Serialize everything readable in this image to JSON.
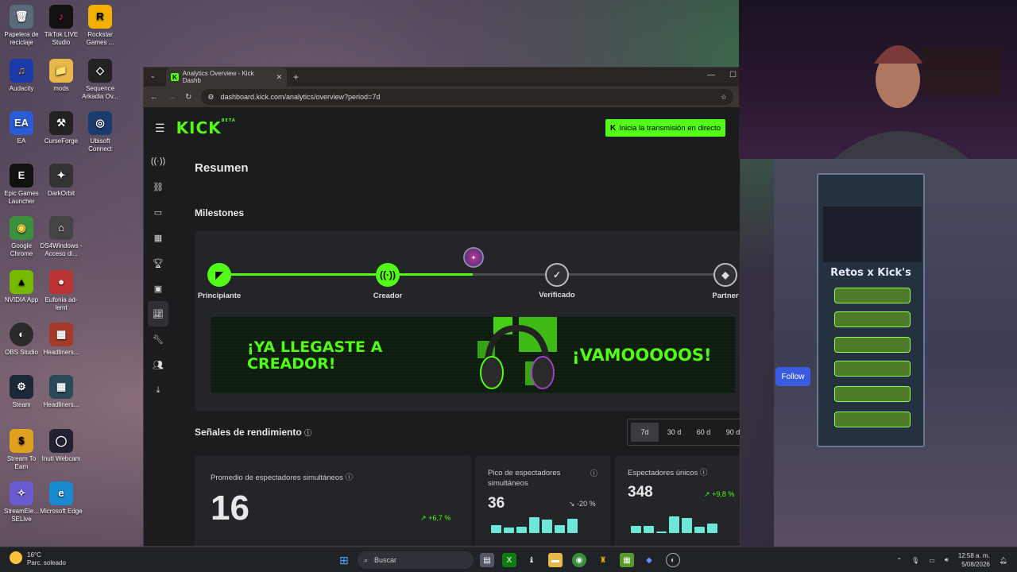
{
  "desktop": {
    "icons": [
      {
        "label": "Papelera de reciclaje",
        "glyph": "🗑"
      },
      {
        "label": "TikTok LIVE Studio",
        "glyph": "♪"
      },
      {
        "label": "Rockstar Games ...",
        "glyph": "R"
      },
      {
        "label": "Audacity",
        "glyph": "♫"
      },
      {
        "label": "mods",
        "glyph": "📁"
      },
      {
        "label": "Sequence Arkadia Ov...",
        "glyph": "◇"
      },
      {
        "label": "EA",
        "glyph": "EA"
      },
      {
        "label": "CurseForge",
        "glyph": "⚒"
      },
      {
        "label": "Ubisoft Connect",
        "glyph": "◎"
      },
      {
        "label": "Epic Games Launcher",
        "glyph": "E"
      },
      {
        "label": "DarkOrbit",
        "glyph": "✦"
      },
      {
        "label": "Google Chrome",
        "glyph": "◉"
      },
      {
        "label": "DS4Windows - Acceso di...",
        "glyph": "⌂"
      },
      {
        "label": "NVIDIA App",
        "glyph": "▲"
      },
      {
        "label": "Eufonia ad-lemt",
        "glyph": "●"
      },
      {
        "label": "OBS Studio",
        "glyph": "◐"
      },
      {
        "label": "Headliners...",
        "glyph": "▦"
      },
      {
        "label": "Steam",
        "glyph": "⚙"
      },
      {
        "label": "Headliners...",
        "glyph": "▦"
      },
      {
        "label": "Stream To Earn",
        "glyph": "$"
      },
      {
        "label": "Inuti Webcam",
        "glyph": "◯"
      },
      {
        "label": "StreamEle... SELive",
        "glyph": "✧"
      },
      {
        "label": "Microsoft Edge",
        "glyph": "e"
      }
    ]
  },
  "browser": {
    "tab_title": "Analytics Overview - Kick Dashb",
    "tab_close": "✕",
    "new_tab": "+",
    "url": "dashboard.kick.com/analytics/overview?period=7d",
    "window_controls": [
      "—",
      "☐"
    ]
  },
  "kick": {
    "logo": "KICK",
    "logo_badge": "BETA",
    "go_live_label": "Inicia la transmisión en directo",
    "sidebar_icons": [
      "broadcast-icon",
      "link-icon",
      "window-icon",
      "calendar-icon",
      "trophy-icon",
      "video-icon",
      "analytics-icon",
      "wrench-icon",
      "users-icon",
      "download-icon"
    ],
    "page_title": "Resumen",
    "milestones": {
      "title": "Milestones",
      "steps": [
        {
          "label": "Principiante",
          "state": "done"
        },
        {
          "label": "Creador",
          "state": "done"
        },
        {
          "label": "Verificado",
          "state": "locked"
        },
        {
          "label": "Partner",
          "state": "locked"
        }
      ],
      "progress_fraction": 0.5,
      "banner_left": "¡YA LLEGASTE A CREADOR!",
      "banner_right": "¡VAMOOOOOS!"
    },
    "performance": {
      "title": "Señales de rendimiento",
      "periods": [
        "7d",
        "30 d",
        "60 d",
        "90 d"
      ],
      "selected_period": "7d",
      "cards": [
        {
          "label": "Promedio de espectadores simultáneos",
          "value": "16",
          "delta": "+6,7 %",
          "trend": "up"
        },
        {
          "label": "Pico de espectadores simultáneos",
          "value": "36",
          "delta": "-20 %",
          "trend": "down",
          "bars": [
            0.45,
            0.3,
            0.35,
            0.9,
            0.75,
            0.45,
            0.8
          ]
        },
        {
          "label": "Espectadores únicos",
          "value": "348",
          "delta": "+9,8 %",
          "trend": "up",
          "bars": [
            0.4,
            0.4,
            0.1,
            0.95,
            0.85,
            0.35,
            0.55
          ]
        }
      ]
    }
  },
  "stream_overlay": {
    "panel_title": "Retos x Kick's",
    "follow_label": "Follow"
  },
  "taskbar": {
    "temperature": "16°C",
    "weather_text": "Parc. soleado",
    "search_placeholder": "Buscar",
    "time": "12:58 a. m.",
    "date": "5/08/2026"
  },
  "colors": {
    "kick_green": "#53fc18",
    "bar_teal": "#6ee7d8"
  }
}
